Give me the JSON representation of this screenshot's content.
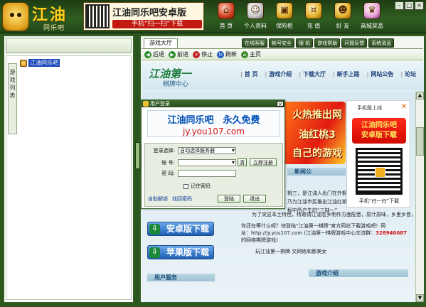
{
  "app": {
    "logo_title": "江油",
    "logo_sub": "同乐吧"
  },
  "banner": {
    "title": "江油同乐吧安卓版",
    "sub": "手机“扫一扫”下载"
  },
  "nav": [
    {
      "label": "首 页",
      "icon": "home-icon",
      "glyph": "⌂"
    },
    {
      "label": "个人资料",
      "icon": "profile-icon",
      "glyph": "☺"
    },
    {
      "label": "保险柜",
      "icon": "safe-icon",
      "glyph": "▣"
    },
    {
      "label": "充 值",
      "icon": "coins-icon",
      "glyph": "¤"
    },
    {
      "label": "好 友",
      "icon": "friends-icon",
      "glyph": "☻"
    },
    {
      "label": "商城奖品",
      "icon": "crown-icon",
      "glyph": "♛"
    }
  ],
  "window_buttons": [
    "-",
    "□",
    "×"
  ],
  "left": {
    "vertical_tab": "游戏列表",
    "tree_item": "江油同乐吧"
  },
  "main": {
    "tab": "游戏大厅",
    "tools": [
      "在线客服",
      "帐号安全",
      "银 机",
      "游戏帮助",
      "问题反馈",
      "系统消息"
    ],
    "toolbar": [
      {
        "label": "后退",
        "color": "#2a8a2a",
        "glyph": "◀"
      },
      {
        "label": "前进",
        "color": "#2a8a2a",
        "glyph": "▶"
      },
      {
        "label": "停止",
        "color": "#c02020",
        "glyph": "×"
      },
      {
        "label": "刷新",
        "color": "#2060c0",
        "glyph": "↻"
      },
      {
        "label": "主页",
        "color": "#3a8a2a",
        "glyph": "⌂"
      }
    ]
  },
  "web": {
    "logo": "江油第一",
    "logo_sub": "棋牌中心",
    "nav": [
      "首 页",
      "游戏介绍",
      "下载大厅",
      "新手上路",
      "网站公告",
      "论坛"
    ],
    "banner_lines": [
      "火热推出网",
      "油红桃3",
      "自己的游戏"
    ],
    "section_news": "新闻公",
    "news_line1": "桃三，是江油人出门在外额",
    "news_line2": "乃为江油市民推出江油红桃",
    "news_line3": "程中所产生的“三缺一”",
    "line_a": "为了突显本土特色，特邀请江油名乡制作方面配音，原汁原味，乡里乡音，",
    "line_b": "你还在等什么呢？快登陆“江油第一棋牌”官方网站下载游戏吧！网",
    "line_c1": "址：http://jy.you107.com",
    "line_c2": "(江油第一棋牌游戏中心交流群：",
    "line_c3": "328940087",
    "line_d": "的网络棋牌游戏)",
    "line_e": "玩江油第一棋牌   交网络和那美女",
    "ad_android": "安卓版下载",
    "ad_apple": "苹果版下载",
    "section_service": "用户服务",
    "section_intro": "游戏介绍"
  },
  "login": {
    "title": "用户登录",
    "slogan_a": "江油同乐吧　永久免费",
    "slogan_b": "jy.you107.com",
    "server_label": "登录选择:",
    "server_value": "自动选择服务器",
    "account_label": "帐 号:",
    "account_value": "",
    "password_label": "密 码:",
    "password_value": "",
    "register": "立即注册",
    "clear": "清",
    "remember": "记住密码",
    "unlock": "自助解锁",
    "recover": "找回密码",
    "login_btn": "登陆",
    "exit_btn": "退出"
  },
  "qr_popup": {
    "header": "手机版上线",
    "title_line1": "江油同乐吧",
    "title_line2": "安卓版下载",
    "footer": "手机“扫一扫”下载",
    "close": "✕"
  }
}
